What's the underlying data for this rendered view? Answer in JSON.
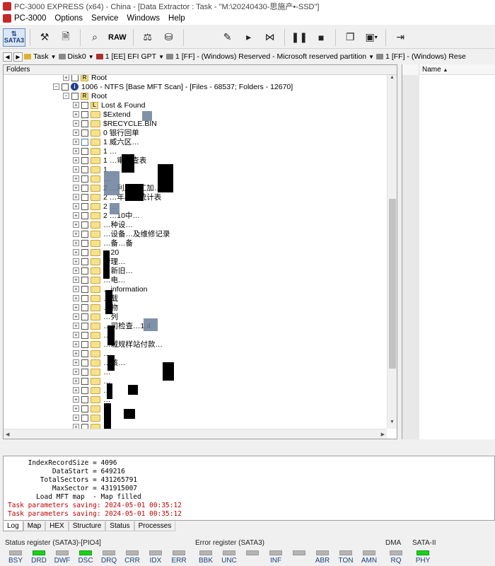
{
  "window": {
    "title": "PC-3000 EXPRESS (x64) - China - [Data Extractor : Task - \"M:\\20240430-思施产•-SSD\"]"
  },
  "menu": [
    "PC-3000",
    "Options",
    "Service",
    "Windows",
    "Help"
  ],
  "toolbar": {
    "sata_label_top": "SATA3",
    "raw_label": "RAW"
  },
  "pathbar": {
    "crumbs": [
      "Task",
      "Disk0",
      "1 [EE] EFI GPT",
      "1 [FF] - (Windows) Reserved - Microsoft reserved partition",
      "1 [FF] - (Windows) Rese"
    ]
  },
  "left_pane": {
    "header": "Folders",
    "root_partial": "Root",
    "partition": "1006 - NTFS [Base MFT Scan] - [Files - 68537; Folders - 12670]",
    "root": "Root",
    "items": [
      "Lost & Found",
      "$Extend",
      "$RECYCLE.BIN",
      "0 银行回单",
      "1 威六区…",
      "1 …",
      "1 …审核查表",
      "1 …",
      "…",
      "2 …利用…工加…",
      "2 …年小…统计表",
      "2 …",
      "2 …10中…",
      "…种设…",
      "…设备…及维修记录",
      "…备…备",
      "…20",
      "管理…",
      "…新旧…",
      "…电…",
      "…information",
      "…载",
      "…物",
      "…列",
      "…司检查…1.4",
      "…",
      "…城规样站付款…",
      "…",
      "…核…",
      "…",
      "…",
      "…",
      "…",
      "…",
      "…",
      "…",
      "…",
      "…"
    ]
  },
  "right_pane": {
    "header": "Name"
  },
  "log": [
    {
      "text": "     IndexRecordSize = 4096",
      "red": false
    },
    {
      "text": "           DataStart = 649216",
      "red": false
    },
    {
      "text": "        TotalSectors = 431265791",
      "red": false
    },
    {
      "text": "           MaxSector = 431915007",
      "red": false
    },
    {
      "text": "       Load MFT map  - Map filled",
      "red": false
    },
    {
      "text": "Task parameters saving: 2024-05-01 00:35:12",
      "red": true
    },
    {
      "text": "Task parameters saving: 2024-05-01 00:35:12",
      "red": true
    }
  ],
  "tabs": [
    "Log",
    "Map",
    "HEX",
    "Structure",
    "Status",
    "Processes"
  ],
  "status": {
    "status_register_title": "Status register (SATA3)-[PIO4]",
    "status_leds": [
      {
        "label": "BSY",
        "on": false
      },
      {
        "label": "DRD",
        "on": true
      },
      {
        "label": "DWF",
        "on": false
      },
      {
        "label": "DSC",
        "on": true
      },
      {
        "label": "DRQ",
        "on": false
      },
      {
        "label": "CRR",
        "on": false
      },
      {
        "label": "IDX",
        "on": false
      },
      {
        "label": "ERR",
        "on": false
      }
    ],
    "error_register_title": "Error register (SATA3)",
    "error_leds": [
      {
        "label": "BBK",
        "on": false
      },
      {
        "label": "UNC",
        "on": false
      },
      {
        "label": "",
        "on": false
      },
      {
        "label": "INF",
        "on": false
      },
      {
        "label": "",
        "on": false
      },
      {
        "label": "ABR",
        "on": false
      },
      {
        "label": "TON",
        "on": false
      },
      {
        "label": "AMN",
        "on": false
      }
    ],
    "dma_title": "DMA",
    "dma_led": {
      "label": "RQ",
      "on": false
    },
    "sata_title": "SATA-II",
    "sata_led": {
      "label": "PHY",
      "on": true
    },
    "accent_on": "#19d219",
    "accent_off": "#b4b4b4"
  }
}
